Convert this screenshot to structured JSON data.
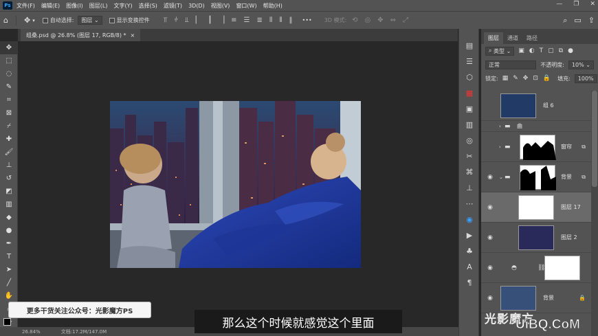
{
  "app": {
    "logo": "Ps",
    "menu": [
      "文件(F)",
      "编辑(E)",
      "图像(I)",
      "图层(L)",
      "文字(Y)",
      "选择(S)",
      "滤镜(T)",
      "3D(D)",
      "视图(V)",
      "窗口(W)",
      "帮助(H)"
    ],
    "window_controls": [
      "—",
      "❐",
      "✕"
    ]
  },
  "options": {
    "auto_select_label": "自动选择:",
    "auto_select_value": "图层",
    "show_transform_label": "显示变换控件",
    "more": "•••",
    "mode_3d_label": "3D 模式:"
  },
  "document": {
    "tab_title": "组桑.psd @ 26.8% (图层 17, RGB/8) *",
    "close": "×"
  },
  "status": {
    "zoom": "26.84%",
    "doc_size": "文档:17.2M/147.0M"
  },
  "overlays": {
    "promo": "更多干货关注公众号：光影魔方PS",
    "subtitle": "那么这个时候就感觉这个里面",
    "watermark_cn": "光影魔方",
    "watermark_url": "UiBQ.CoM"
  },
  "layers_panel": {
    "tabs": [
      "图层",
      "通道",
      "路径"
    ],
    "filter_label": "类型",
    "blend_mode": "正常",
    "opacity_label": "不透明度:",
    "opacity_value": "10%",
    "lock_label": "锁定:",
    "fill_label": "填充:",
    "fill_value": "100%",
    "layers": [
      {
        "name": "组 6"
      },
      {
        "name": "曲"
      },
      {
        "name": "窗帘"
      },
      {
        "name": "背景"
      },
      {
        "name": "图层 17"
      },
      {
        "name": "图层 2"
      },
      {
        "name": ""
      },
      {
        "name": "背景"
      }
    ]
  },
  "colors": {
    "accent": "#31a8ff",
    "panel": "#535353",
    "canvas_bg": "#282828"
  }
}
